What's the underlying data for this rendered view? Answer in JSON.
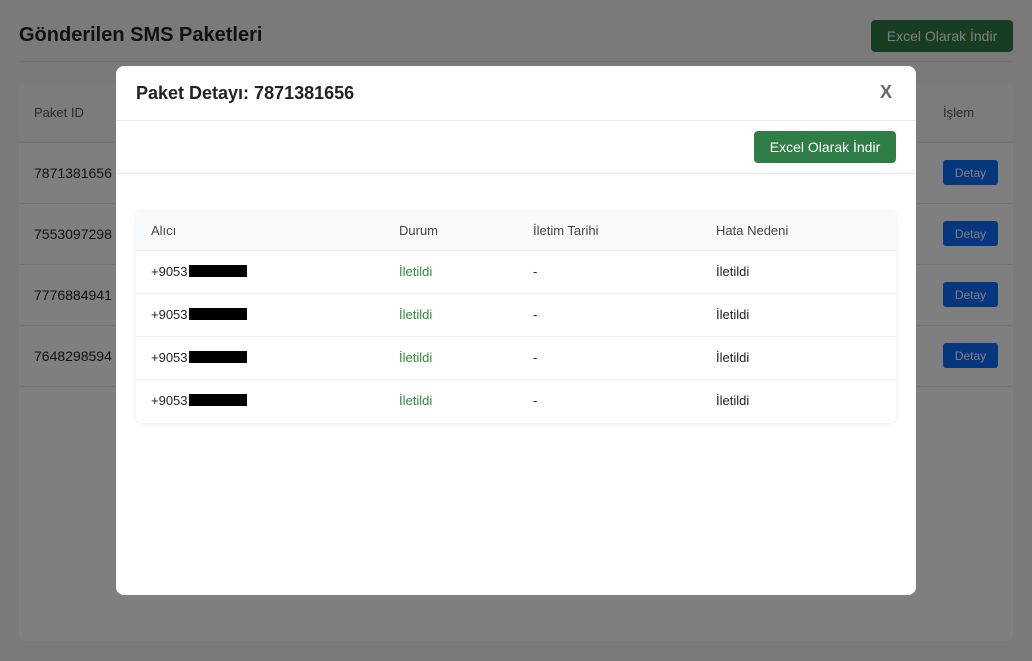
{
  "page": {
    "title": "Gönderilen SMS Paketleri",
    "excel_label": "Excel Olarak İndir",
    "table": {
      "headers": [
        "Paket ID",
        "İşlem"
      ],
      "rows": [
        {
          "id": "7871381656",
          "action": "Detay"
        },
        {
          "id": "7553097298",
          "action": "Detay"
        },
        {
          "id": "7776884941",
          "action": "Detay"
        },
        {
          "id": "7648298594",
          "action": "Detay"
        }
      ]
    }
  },
  "modal": {
    "title": "Paket Detayı: 7871381656",
    "close_label": "X",
    "excel_label": "Excel Olarak İndir",
    "table": {
      "headers": [
        "Alıcı",
        "Durum",
        "İletim Tarihi",
        "Hata Nedeni"
      ],
      "rows": [
        {
          "recipient": "+9053",
          "status": "İletildi",
          "delivery_date": "-",
          "error_reason": "İletildi"
        },
        {
          "recipient": "+9053",
          "status": "İletildi",
          "delivery_date": "-",
          "error_reason": "İletildi"
        },
        {
          "recipient": "+9053",
          "status": "İletildi",
          "delivery_date": "-",
          "error_reason": "İletildi"
        },
        {
          "recipient": "+9053",
          "status": "İletildi",
          "delivery_date": "-",
          "error_reason": "İletildi"
        }
      ]
    }
  },
  "colors": {
    "accent_green": "#2e7d46",
    "status_green": "#2e8b3e",
    "detail_blue": "#0d6efd"
  }
}
